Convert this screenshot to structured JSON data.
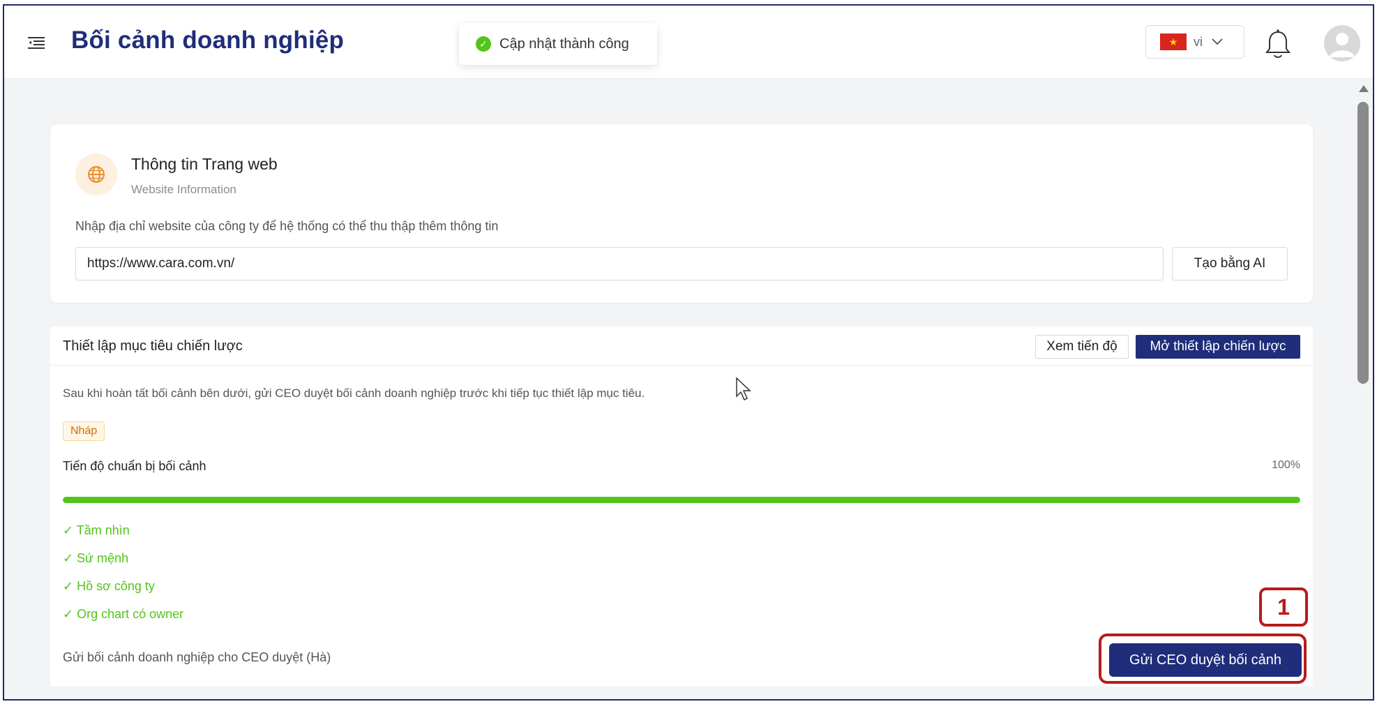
{
  "header": {
    "title": "Bối cảnh doanh nghiệp",
    "toast_message": "Cập nhật thành công",
    "language": "vi"
  },
  "website_card": {
    "title": "Thông tin Trang web",
    "subtitle": "Website Information",
    "description": "Nhập địa chỉ website của công ty để hệ thống có thể thu thập thêm thông tin",
    "url_value": "https://www.cara.com.vn/",
    "ai_button_label": "Tạo bằng AI"
  },
  "strategy_card": {
    "title": "Thiết lập mục tiêu chiến lược",
    "view_progress_label": "Xem tiến độ",
    "open_setup_label": "Mở thiết lập chiến lược",
    "description": "Sau khi hoàn tất bối cảnh bên dưới, gửi CEO duyệt bối cảnh doanh nghiệp trước khi tiếp tục thiết lập mục tiêu.",
    "status_badge": "Nháp",
    "progress_label": "Tiến độ chuẩn bị bối cảnh",
    "progress_text": "100%",
    "progress_value": 1.0,
    "checklist": [
      "✓ Tầm nhìn",
      "✓ Sứ mệnh",
      "✓ Hồ sơ công ty",
      "✓ Org chart có owner"
    ],
    "send_label": "Gửi bối cảnh doanh nghiệp cho CEO duyệt (Hà)",
    "send_button_label": "Gửi CEO duyệt bối cảnh"
  },
  "annotation": {
    "step_number": "1"
  },
  "colors": {
    "primary": "#1f2d7a",
    "success": "#52c41a",
    "annotation": "#b71c1c"
  }
}
